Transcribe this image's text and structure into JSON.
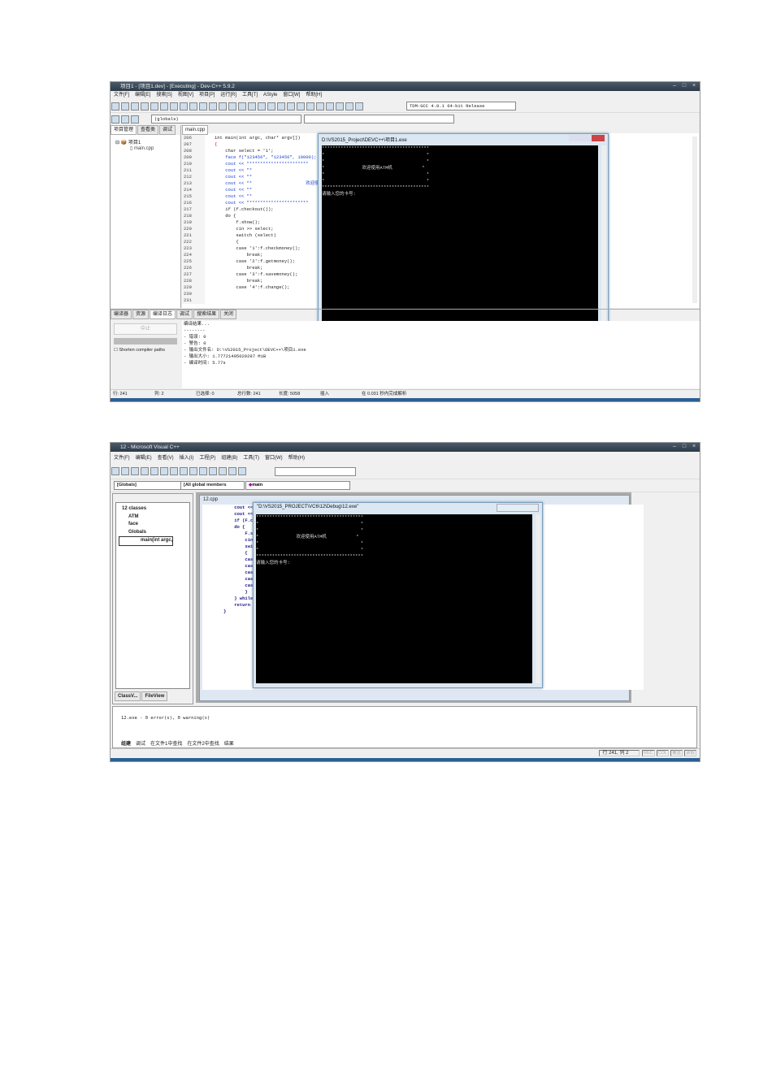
{
  "devcpp": {
    "title": "项目1 - [项目1.dev] - [Executing] - Dev-C++ 5.9.2",
    "menu": [
      "文件[F]",
      "编辑[E]",
      "搜索[S]",
      "视图[V]",
      "项目[P]",
      "运行[R]",
      "工具[T]",
      "AStyle",
      "窗口[W]",
      "帮助[H]"
    ],
    "compiler": "TDM-GCC 4.8.1 64-bit Release",
    "scope": "(globals)",
    "left_tabs": [
      "项目管理",
      "查看类",
      "调试"
    ],
    "project": "项目1",
    "file": "main.cpp",
    "editor_tab": "main.cpp",
    "line_numbers": [
      "206",
      "207",
      "208",
      "209",
      "210",
      "211",
      "212",
      "213",
      "214",
      "215",
      "216",
      "217",
      "218",
      "219",
      "220",
      "221",
      "222",
      "223",
      "224",
      "225",
      "226",
      "227",
      "228",
      "229",
      "230",
      "231"
    ],
    "code": [
      "int main(int argc, char* argv[])",
      "{",
      "    char select = '1';",
      "    face f(\"123456\", \"123456\", 10000);",
      "",
      "    cout << \"**********************",
      "    cout << \"*",
      "    cout << \"*",
      "    cout << \"*                    欢迎使用",
      "    cout << \"*",
      "    cout << \"*",
      "    cout << \"**********************",
      "",
      "    if (f.checkout());",
      "    do {",
      "        f.show();",
      "        cin >> select;",
      "        switch (select)",
      "        {",
      "        case '1':f.checkmoney();",
      "            break;",
      "        case '2':f.getmoney();",
      "            break;",
      "        case '3':f.savemoney();",
      "            break;",
      "        case '4':f.change();"
    ],
    "console_title": "D:\\VS2015_Project\\DEVC++\\项目1.exe",
    "console_lines": [
      "****************************************",
      "*                                      *",
      "*                                      *",
      "*              欢迎使用ATM机           *",
      "*                                      *",
      "*                                      *",
      "****************************************",
      "请输入您的卡号:"
    ],
    "bottom_tabs": [
      "编译器",
      "资源",
      "编译日志",
      "调试",
      "搜索结果",
      "关闭"
    ],
    "abort_button": "中止",
    "shorten_label": "Shorten compiler paths",
    "log": [
      "编译结果...",
      "--------",
      "- 错误: 0",
      "- 警告: 0",
      "- 输出文件名: D:\\VS2015_Project\\DEVC++\\项目1.exe",
      "- 输出大小: 1.77721405029297 MiB",
      "- 编译时间: 5.77s"
    ],
    "status": [
      "行: 241",
      "列: 2",
      "已选择: 0",
      "总行数: 241",
      "长度: 5058",
      "插入",
      "在 0.031 秒内完成解析"
    ]
  },
  "vc6": {
    "title": "12 - Microsoft Visual C++",
    "menu": [
      "文件(F)",
      "编辑(E)",
      "查看(V)",
      "插入(I)",
      "工程(P)",
      "组建(B)",
      "工具(T)",
      "窗口(W)",
      "帮助(H)"
    ],
    "combo_globals": "[Globals]",
    "combo_members": "[All global members",
    "combo_main": "main",
    "tree": [
      "12 classes",
      "ATM",
      "face",
      "Globals",
      "main(int argc,"
    ],
    "left_tabs": [
      "ClassV...",
      "FileView"
    ],
    "editor_title": "12.cpp",
    "code": [
      "    cout <<",
      "    cout <<",
      "",
      "    if (F.ch",
      "    do {",
      "        F.sh",
      "        cin",
      "        swit",
      "        {",
      "        case",
      "",
      "        case",
      "",
      "        case",
      "",
      "        case",
      "",
      "        case",
      "",
      "",
      "",
      "        }",
      "    } while",
      "",
      "    return 0",
      "}"
    ],
    "console_title": "\"D:\\VS2015_PROJECT\\VC6\\12\\Debug\\12.exe\"",
    "console_lines": [
      "****************************************",
      "*                                      *",
      "*                                      *",
      "*              欢迎使用ATM机           *",
      "*                                      *",
      "*                                      *",
      "****************************************",
      "请输入您的卡号:"
    ],
    "output": "12.exe - 0 error(s), 0 warning(s)",
    "output_tabs": [
      "组建",
      "调试",
      "在文件1中查找",
      "在文件2中查找",
      "结果"
    ],
    "status_pos": "行 241, 列 2",
    "status_flags": [
      "REC",
      "COL",
      "覆盖",
      "读取"
    ]
  }
}
